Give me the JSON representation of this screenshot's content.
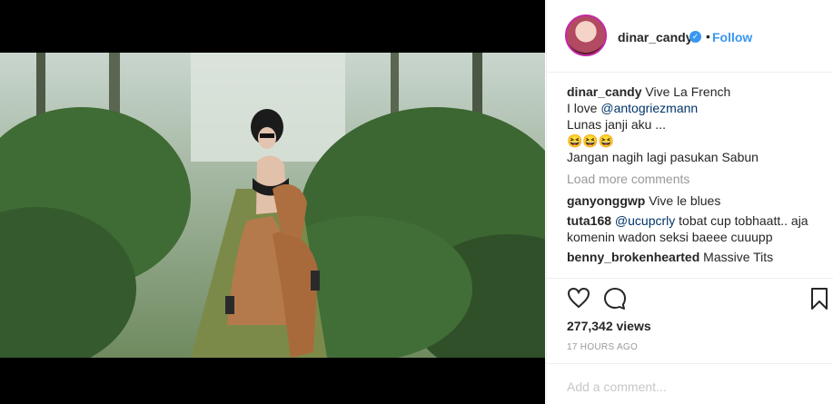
{
  "post": {
    "username": "dinar_candy",
    "follow_label": "Follow",
    "dot": "•"
  },
  "caption": {
    "author": "dinar_candy",
    "line1": "Vive La French",
    "line2_prefix": "I love ",
    "line2_mention": "@antogriezmann",
    "line3": "Lunas janji aku ...",
    "line4_emoji": "😆😆😆",
    "line5": "Jangan nagih lagi pasukan Sabun"
  },
  "load_more": "Load more comments",
  "comments": [
    {
      "user": "ganyonggwp",
      "mention": "",
      "text": "Vive le blues"
    },
    {
      "user": "tuta168",
      "mention": "@ucupcrly",
      "text": "tobat cup tobhaatt.. aja komenin wadon seksi baeee cuuupp"
    },
    {
      "user": "benny_brokenhearted",
      "mention": "",
      "text": "Massive Tits"
    }
  ],
  "stats": {
    "views": "277,342 views",
    "time": "17 HOURS AGO"
  },
  "add_comment_placeholder": "Add a comment...",
  "colors": {
    "accent": "#3897f0",
    "text": "#262626",
    "muted": "#999999"
  },
  "icons": [
    "heart-icon",
    "comment-icon",
    "bookmark-icon",
    "verified-icon"
  ]
}
